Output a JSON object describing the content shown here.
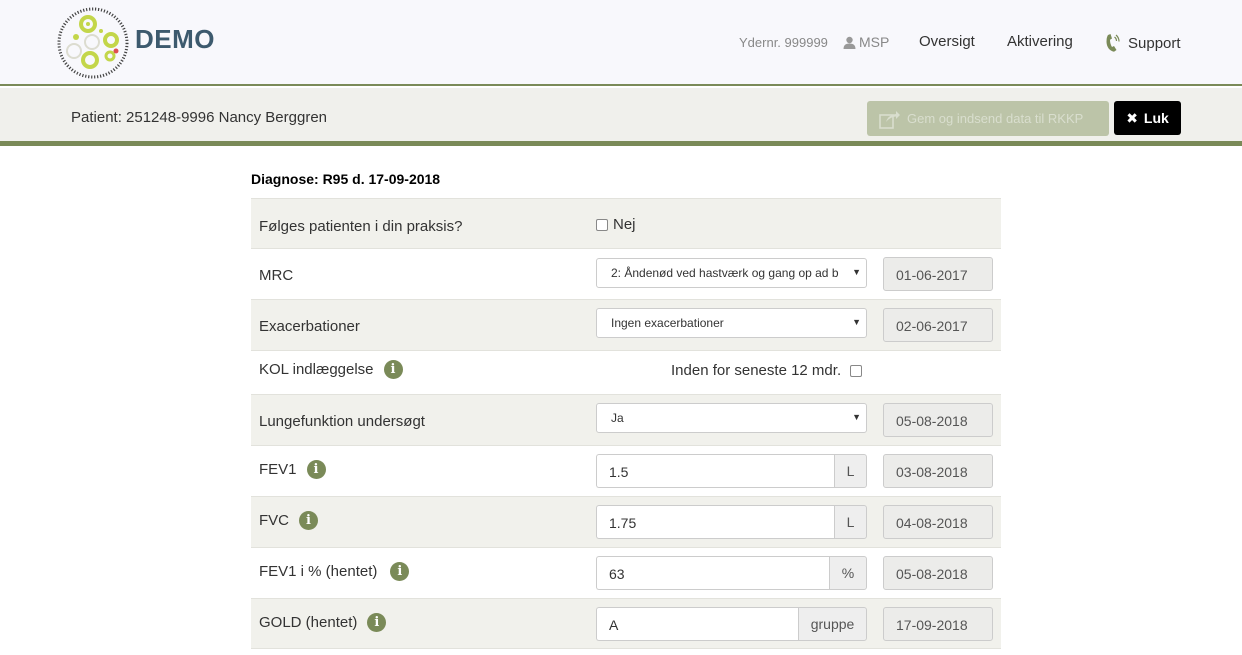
{
  "brand": {
    "name": "DEMO"
  },
  "nav": {
    "ydernr": "Ydernr. 999999",
    "user": "MSP",
    "oversigt": "Oversigt",
    "aktivering": "Aktivering",
    "support": "Support"
  },
  "patient": {
    "label": "Patient: 251248-9996 Nancy Berggren",
    "save_button": "Gem og indsend data til RKKP",
    "close_button": "Luk"
  },
  "diagnose": "Diagnose: R95 d. 17-09-2018",
  "form": {
    "foelges": {
      "label": "Følges patienten i din praksis?",
      "checkbox_label": "Nej"
    },
    "mrc": {
      "label": "MRC",
      "value": "2: Åndenød ved hastværk og gang op ad b",
      "date": "01-06-2017"
    },
    "exacerbationer": {
      "label": "Exacerbationer",
      "value": "Ingen exacerbationer",
      "date": "02-06-2017"
    },
    "kol": {
      "label": "KOL indlæggelse",
      "checkbox_label": "Inden for seneste 12 mdr."
    },
    "lungefunktion": {
      "label": "Lungefunktion undersøgt",
      "value": "Ja",
      "date": "05-08-2018"
    },
    "fev1": {
      "label": "FEV1",
      "value": "1.5",
      "unit": "L",
      "date": "03-08-2018"
    },
    "fvc": {
      "label": "FVC",
      "value": "1.75",
      "unit": "L",
      "date": "04-08-2018"
    },
    "fev1pct": {
      "label": "FEV1 i % (hentet)",
      "value": "63",
      "unit": "%",
      "date": "05-08-2018"
    },
    "gold": {
      "label": "GOLD (hentet)",
      "value": "A",
      "unit": "gruppe",
      "date": "17-09-2018"
    }
  },
  "colors": {
    "accent": "#7a8a58",
    "brand": "#3d5a6e",
    "logo_green": "#c3d64a"
  }
}
